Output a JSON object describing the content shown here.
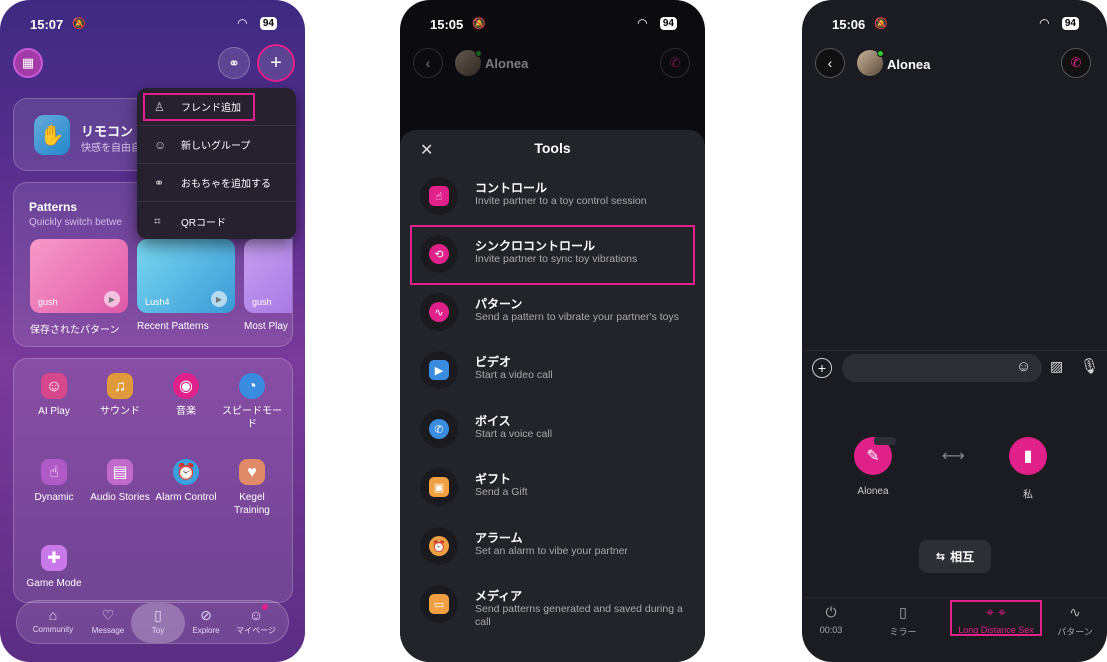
{
  "status1": {
    "time": "15:07",
    "battery": "94"
  },
  "status2": {
    "time": "15:05",
    "battery": "94"
  },
  "status3": {
    "time": "15:06",
    "battery": "94"
  },
  "screen1": {
    "remote": {
      "title": "リモコン",
      "subtitle": "快感を自由自"
    },
    "patterns": {
      "title": "Patterns",
      "subtitle": "Quickly switch betwe",
      "cards": [
        {
          "toy": "gush",
          "caption": "保存されたパターン"
        },
        {
          "toy": "Lush4",
          "caption": "Recent Patterns"
        },
        {
          "toy": "gush",
          "caption": "Most Play"
        }
      ]
    },
    "features": [
      {
        "label": "AI Play",
        "icon": "ai-play-icon",
        "color": "#d7478c"
      },
      {
        "label": "サウンド",
        "icon": "sound-icon",
        "color": "#e09a3a"
      },
      {
        "label": "音楽",
        "icon": "music-icon",
        "color": "#e0218a"
      },
      {
        "label": "スピードモード",
        "icon": "speed-icon",
        "color": "#3a8ce0"
      },
      {
        "label": "Dynamic",
        "icon": "dynamic-icon",
        "color": "#b05ac8"
      },
      {
        "label": "Audio Stories",
        "icon": "audio-stories-icon",
        "color": "#c06acb"
      },
      {
        "label": "Alarm Control",
        "icon": "alarm-icon",
        "color": "#3aa0e0"
      },
      {
        "label": "Kegel Training",
        "icon": "kegel-icon",
        "color": "#e08a6a"
      },
      {
        "label": "Game Mode",
        "icon": "game-icon",
        "color": "#c878e8"
      }
    ],
    "dropdown": [
      "フレンド追加",
      "新しいグループ",
      "おもちゃを追加する",
      "QRコード"
    ],
    "tabs": [
      "Community",
      "Message",
      "Toy",
      "Explore",
      "マイページ"
    ]
  },
  "screen2": {
    "contact": "Alonea",
    "sheet_title": "Tools",
    "tools": [
      {
        "name": "コントロール",
        "desc": "Invite partner to a toy control session",
        "color": "#e0218a",
        "icon": "control-icon"
      },
      {
        "name": "シンクロコントロール",
        "desc": "Invite partner to sync toy vibrations",
        "color": "#e0218a",
        "icon": "sync-control-icon"
      },
      {
        "name": "パターン",
        "desc": "Send a pattern to vibrate your partner's toys",
        "color": "#e0218a",
        "icon": "pattern-icon"
      },
      {
        "name": "ビデオ",
        "desc": "Start a video call",
        "color": "#3a8ce0",
        "icon": "video-icon"
      },
      {
        "name": "ボイス",
        "desc": "Start a voice call",
        "color": "#3a8ce0",
        "icon": "voice-icon"
      },
      {
        "name": "ギフト",
        "desc": "Send a Gift",
        "color": "#f0a040",
        "icon": "gift-icon"
      },
      {
        "name": "アラーム",
        "desc": "Set an alarm to vibe your partner",
        "color": "#f0a040",
        "icon": "alarm-icon"
      },
      {
        "name": "メディア",
        "desc": "Send patterns generated and saved during a call",
        "color": "#f0a040",
        "icon": "media-icon"
      }
    ]
  },
  "screen3": {
    "contact": "Alonea",
    "partner_device": "Alonea",
    "my_device": "私",
    "mode": "相互",
    "bottom": [
      {
        "label": "00:03",
        "icon": "power-icon"
      },
      {
        "label": "ミラー",
        "icon": "mirror-icon"
      },
      {
        "label": "Long Distance Sex",
        "icon": "location-icon"
      },
      {
        "label": "パターン",
        "icon": "wave-icon"
      }
    ]
  }
}
